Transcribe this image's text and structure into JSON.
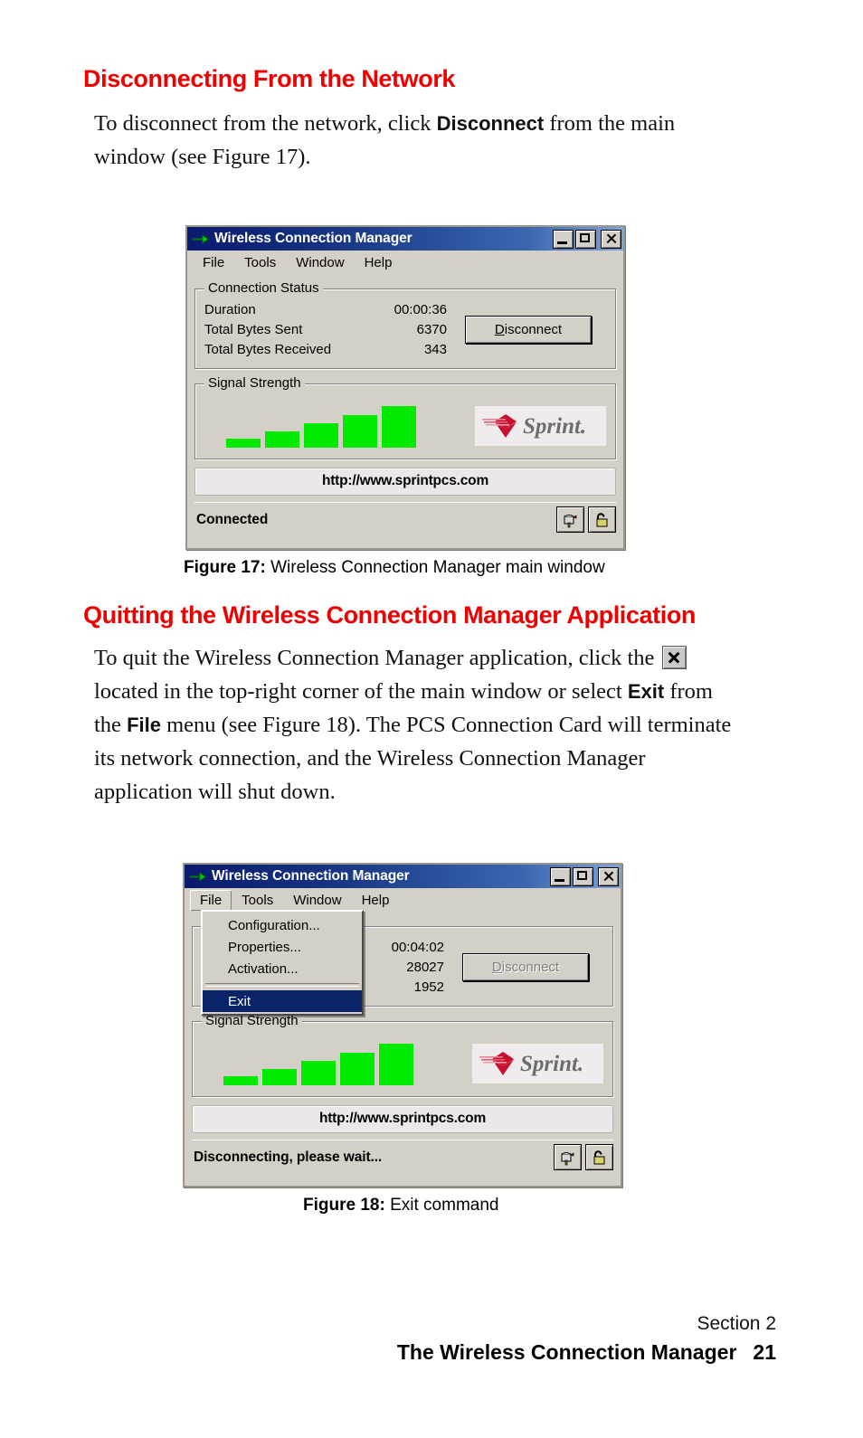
{
  "page": {
    "number": "21",
    "footer_section": "Section 2",
    "footer_title": "The Wireless Connection Manager"
  },
  "sections": [
    {
      "heading": "Disconnecting From the Network",
      "paragraph_before": "To disconnect from the network, click ",
      "paragraph_bold": "Disconnect",
      "paragraph_after": " from the main window (see Figure 17)."
    },
    {
      "heading": "Quitting the Wireless Connection Manager Application",
      "p1": "To quit the Wireless Connection Manager application, click the ",
      "p2": " located in the top-right corner of the main window or select ",
      "p2_bold": "Exit",
      "p3": " from the ",
      "p3_bold": "File",
      "p4": " menu (see Figure 18). The PCS Connection Card will terminate its network connection, and the Wireless Connection Manager application will shut down."
    }
  ],
  "figures": [
    {
      "caption_label": "Figure 17:",
      "caption_text": "Wireless Connection Manager main window"
    },
    {
      "caption_label": "Figure 18:",
      "caption_text": "Exit command"
    }
  ],
  "window": {
    "title": "Wireless Connection Manager",
    "menu_items": [
      "File",
      "Tools",
      "Window",
      "Help"
    ],
    "buttons": {
      "minimize": "minimize",
      "maximize": "maximize",
      "close": "close"
    },
    "file_menu": {
      "items": [
        "Configuration...",
        "Properties...",
        "Activation..."
      ],
      "exit_item": "Exit"
    },
    "groups": {
      "connection_status": "Connection Status",
      "signal_strength": "Signal Strength"
    },
    "row_labels": [
      "Duration",
      "Total Bytes Sent",
      "Total Bytes Received"
    ],
    "disconnect_button": "Disconnect",
    "disconnect_accel": "D",
    "url": "http://www.sprintpcs.com",
    "brand": "Sprint.",
    "signal_bars": [
      5,
      5,
      5,
      5,
      5
    ],
    "signal_bar_heights": [
      10,
      18,
      27,
      36,
      46
    ],
    "icons": {
      "mailbox": "mailbox-icon",
      "padlock": "padlock-open-icon",
      "title": "green-arrow-icon"
    }
  },
  "fig17": {
    "values": [
      "00:00:36",
      "6370",
      "343"
    ],
    "status": "Connected",
    "disconnect_enabled": true
  },
  "fig18": {
    "values": [
      "00:04:02",
      "28027",
      "1952"
    ],
    "status": "Disconnecting, please wait...",
    "disconnect_enabled": false
  },
  "colors": {
    "heading_red": "#ee0000",
    "titlebar_blue": "#0a1a6e",
    "menu_highlight": "#0a246a",
    "signal_green": "#00ea00",
    "window_face": "#d4d0c8",
    "sprint_red": "#c8102e"
  }
}
